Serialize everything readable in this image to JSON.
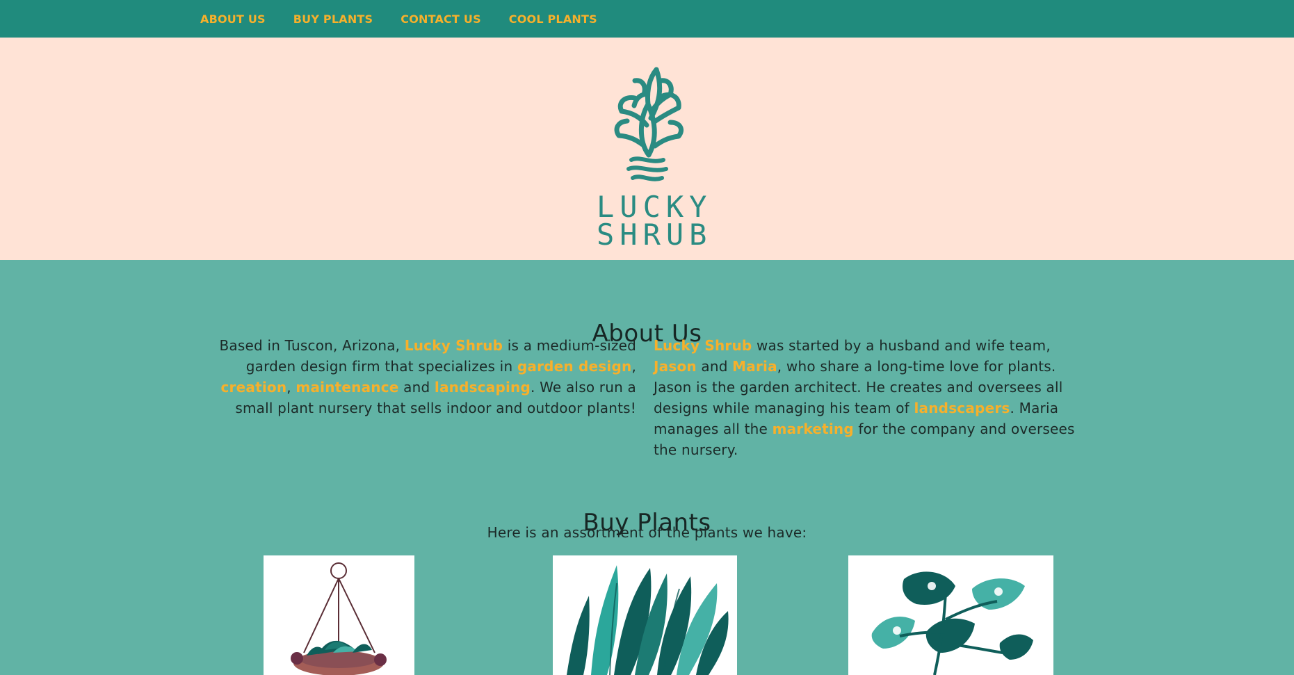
{
  "nav": {
    "items": [
      {
        "label": "ABOUT US"
      },
      {
        "label": "BUY PLANTS"
      },
      {
        "label": "CONTACT US"
      },
      {
        "label": "COOL PLANTS"
      }
    ]
  },
  "hero": {
    "logo_text_line1": "LUCKY",
    "logo_text_line2": "SHRUB"
  },
  "about": {
    "title": "About Us",
    "left_paragraph": [
      {
        "text": "Based in Tuscon, Arizona, "
      },
      {
        "text": "Lucky Shrub",
        "highlight": true
      },
      {
        "text": " is a medium-sized garden design firm that specializes in "
      },
      {
        "text": "garden design",
        "highlight": true
      },
      {
        "text": ", "
      },
      {
        "text": "creation",
        "highlight": true
      },
      {
        "text": ", "
      },
      {
        "text": "maintenance",
        "highlight": true
      },
      {
        "text": " and "
      },
      {
        "text": "landscaping",
        "highlight": true
      },
      {
        "text": ". We also run a small plant nursery that sells indoor and outdoor plants!"
      }
    ],
    "right_paragraph": [
      {
        "text": "Lucky Shrub",
        "highlight": true
      },
      {
        "text": " was started by a husband and wife team, "
      },
      {
        "text": "Jason",
        "highlight": true
      },
      {
        "text": " and "
      },
      {
        "text": "Maria",
        "highlight": true
      },
      {
        "text": ", who share a long-time love for plants. Jason is the garden architect. He creates and oversees all designs while managing his team of "
      },
      {
        "text": "landscapers",
        "highlight": true
      },
      {
        "text": ". Maria manages all the "
      },
      {
        "text": "marketing",
        "highlight": true
      },
      {
        "text": " for the company and oversees the nursery."
      }
    ]
  },
  "buy": {
    "title": "Buy Plants",
    "subtitle": "Here is an assortment of the plants we have:"
  },
  "colors": {
    "nav_bg": "#208b7d",
    "nav_link": "#f7b02b",
    "hero_bg": "#ffe3d6",
    "main_bg": "#61b3a5",
    "highlight": "#f7b02b",
    "logo": "#2a8b82"
  },
  "icons": {
    "logo": "plant-logo-icon",
    "plant1": "hanging-basket-plant-image",
    "plant2": "snake-plant-image",
    "plant3": "monstera-plant-image"
  }
}
